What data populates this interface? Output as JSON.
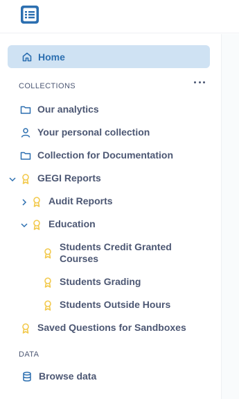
{
  "sidebar": {
    "home_label": "Home",
    "collections_heading": "COLLECTIONS",
    "items": [
      {
        "label": "Our analytics",
        "icon": "folder-icon"
      },
      {
        "label": "Your personal collection",
        "icon": "person-icon"
      },
      {
        "label": "Collection for Documentation",
        "icon": "folder-icon"
      },
      {
        "label": "GEGI Reports",
        "icon": "badge-icon",
        "expanded": true
      },
      {
        "label": "Audit Reports",
        "icon": "badge-icon",
        "expanded": false
      },
      {
        "label": "Education",
        "icon": "badge-icon",
        "expanded": true
      },
      {
        "label": "Students Credit Granted Courses",
        "icon": "badge-icon"
      },
      {
        "label": "Students Grading",
        "icon": "badge-icon"
      },
      {
        "label": "Students Outside Hours",
        "icon": "badge-icon"
      },
      {
        "label": "Saved Questions for Sandboxes",
        "icon": "badge-icon"
      }
    ],
    "data_heading": "DATA",
    "browse_data_label": "Browse data"
  },
  "colors": {
    "accent": "#2c6fb0",
    "home_bg": "#cfe2f3",
    "official_badge": "#f2c94c",
    "text": "#4c5773"
  }
}
